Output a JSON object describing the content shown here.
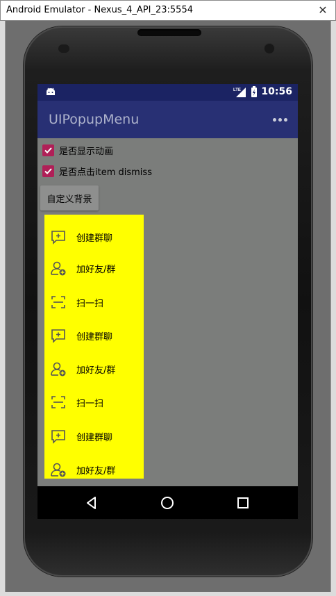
{
  "window": {
    "title": "Android Emulator - Nexus_4_API_23:5554",
    "close_glyph": "✕"
  },
  "statusbar": {
    "time": "10:56",
    "network": "LTE",
    "icons": [
      "android-icon",
      "lte-signal-icon",
      "battery-icon"
    ]
  },
  "appbar": {
    "title": "UIPopupMenu",
    "overflow_icon": "more-options-icon"
  },
  "options": [
    {
      "label": "是否显示动画",
      "checked": true
    },
    {
      "label": "是否点击item dismiss",
      "checked": true
    }
  ],
  "custom_bg_button": {
    "label": "自定义背景"
  },
  "popup": {
    "background": "#ffff00",
    "items": [
      {
        "label": "创建群聊",
        "icon": "chat-add-icon"
      },
      {
        "label": "加好友/群",
        "icon": "add-friend-icon"
      },
      {
        "label": "扫一扫",
        "icon": "scan-icon"
      },
      {
        "label": "创建群聊",
        "icon": "chat-add-icon"
      },
      {
        "label": "加好友/群",
        "icon": "add-friend-icon"
      },
      {
        "label": "扫一扫",
        "icon": "scan-icon"
      },
      {
        "label": "创建群聊",
        "icon": "chat-add-icon"
      },
      {
        "label": "加好友/群",
        "icon": "add-friend-icon"
      }
    ]
  },
  "navbar": {
    "buttons": [
      "back-icon",
      "home-icon",
      "recents-icon"
    ]
  },
  "colors": {
    "status_bar": "#1b2363",
    "app_bar": "#283074",
    "accent": "#b01f57",
    "screen_bg": "#7b7d7b"
  }
}
